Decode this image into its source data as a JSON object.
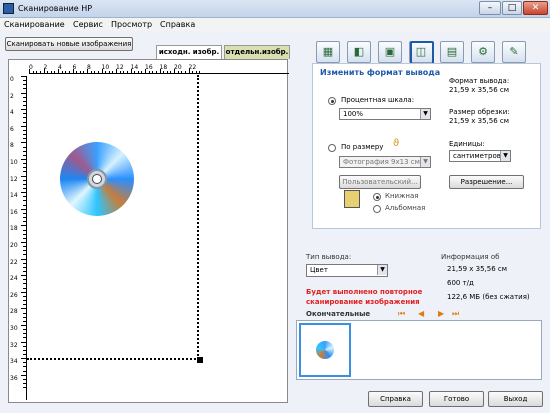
{
  "window": {
    "title": "Сканирование HP",
    "min": "–",
    "max": "□",
    "close": "✕"
  },
  "menu": [
    "Сканирование",
    "Сервис",
    "Просмотр",
    "Справка"
  ],
  "toolbar": {
    "scan_new": "Сканировать новые изображения",
    "tab_original": "исходн. изобр.",
    "tab_separate": "отдельн.изобр."
  },
  "ruler": {
    "h": [
      "0",
      "2",
      "4",
      "6",
      "8",
      "10",
      "12",
      "14",
      "16",
      "18",
      "20",
      "22"
    ],
    "v": [
      "0",
      "2",
      "4",
      "6",
      "8",
      "10",
      "12",
      "14",
      "16",
      "18",
      "20",
      "22",
      "24",
      "26",
      "28",
      "30",
      "32",
      "34",
      "36"
    ]
  },
  "tools": [
    "image-adjust-icon",
    "color-adjust-icon",
    "crop-icon",
    "resize-icon",
    "output-icon",
    "settings-icon",
    "tools-icon"
  ],
  "resize": {
    "header": "Изменить формат вывода",
    "scale_label": "Процентная шкала:",
    "scale_value": "100%",
    "size_label": "По размеру",
    "preset_value": "Фотография 9x13 см",
    "custom_button": "Пользовательский...",
    "portrait": "Книжная",
    "landscape": "Альбомная",
    "out_format_label": "Формат вывода:",
    "out_format": "21,59 x 35,56 см",
    "crop_label": "Размер обрезки:",
    "crop_size": "21,59 x 35,56 см",
    "units_label": "Единицы:",
    "units_value": "сантиметров",
    "resolution_button": "Разрешение..."
  },
  "output": {
    "type_label": "Тип вывода:",
    "type_value": "Цвет",
    "info_label": "Информация об",
    "info_size": "21,59 x 35,56 см",
    "info_dpi": "600 т/д",
    "info_mem": "122,6 МБ (без сжатия)",
    "warning_line1": "Будет выполнено повторное",
    "warning_line2": "сканирование изображения",
    "final_label": "Окончательные"
  },
  "bottom": {
    "help": "Справка",
    "done": "Готово",
    "exit": "Выход"
  },
  "nav_icons": [
    "nav-first-icon",
    "nav-prev-icon",
    "nav-next-icon",
    "nav-last-icon"
  ],
  "colors": {
    "accent": "#1f5aa8",
    "warning": "#e02020",
    "nav": "#e07a10"
  }
}
